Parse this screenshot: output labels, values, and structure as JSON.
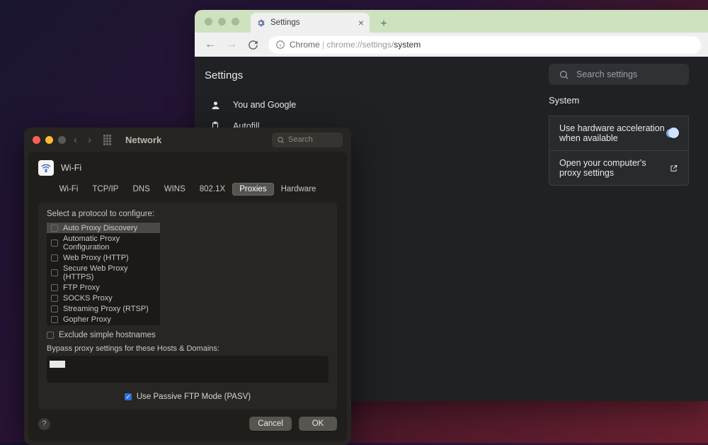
{
  "chrome": {
    "tab_title": "Settings",
    "url_prefix": "Chrome",
    "url_path": "chrome://settings/",
    "url_suffix": "system",
    "page_title": "Settings",
    "search_placeholder": "Search settings",
    "sidebar": [
      {
        "icon": "person",
        "label": "You and Google"
      },
      {
        "icon": "clipboard",
        "label": "Autofill"
      }
    ],
    "section_title": "System",
    "rows": {
      "hw_accel": "Use hardware acceleration when available",
      "proxy": "Open your computer's proxy settings"
    }
  },
  "network": {
    "window_title": "Network",
    "search_placeholder": "Search",
    "wifi_title": "Wi-Fi",
    "tabs": [
      "Wi-Fi",
      "TCP/IP",
      "DNS",
      "WINS",
      "802.1X",
      "Proxies",
      "Hardware"
    ],
    "active_tab": "Proxies",
    "select_label": "Select a protocol to configure:",
    "protocols": [
      "Auto Proxy Discovery",
      "Automatic Proxy Configuration",
      "Web Proxy (HTTP)",
      "Secure Web Proxy (HTTPS)",
      "FTP Proxy",
      "SOCKS Proxy",
      "Streaming Proxy (RTSP)",
      "Gopher Proxy"
    ],
    "exclude_label": "Exclude simple hostnames",
    "bypass_label": "Bypass proxy settings for these Hosts & Domains:",
    "pasv_label": "Use Passive FTP Mode (PASV)",
    "cancel": "Cancel",
    "ok": "OK"
  }
}
